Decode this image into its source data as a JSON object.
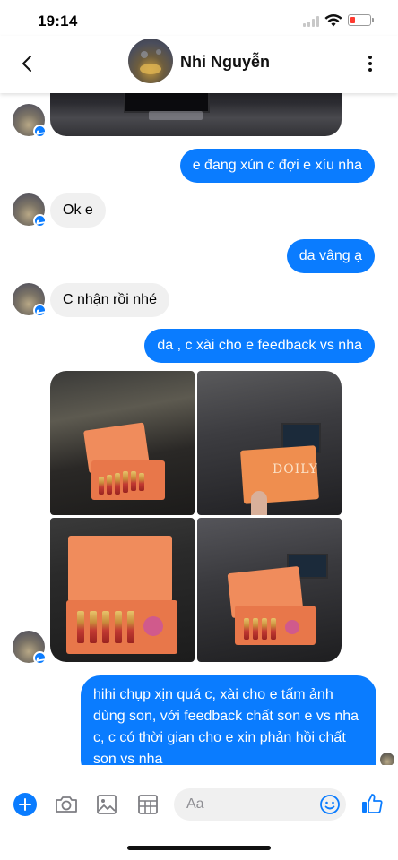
{
  "status": {
    "time": "19:14"
  },
  "contact": {
    "name": "Nhi Nguyễn"
  },
  "messages": [
    {
      "dir": "out",
      "text": "e đang xún c đợi e xíu nha"
    },
    {
      "dir": "in",
      "text": "Ok e"
    },
    {
      "dir": "out",
      "text": "da vâng ạ"
    },
    {
      "dir": "in",
      "text": "C nhận rồi nhé"
    },
    {
      "dir": "out",
      "text": "da , c xài cho e feedback vs nha"
    },
    {
      "dir": "out",
      "text": "hihi chụp xịn quá c, xài cho e tấm ảnh dùng son, với feedback chất son e vs nha c, c có thời gian cho e xin phản hồi chất son vs nha"
    }
  ],
  "photos": {
    "envelope_text": "DOILY"
  },
  "composer": {
    "placeholder": "Aa"
  },
  "colors": {
    "accent": "#0a7cff",
    "incoming_bubble": "#f0f0f0",
    "battery_low": "#ff3b30"
  },
  "icons": [
    "back-arrow-icon",
    "more-vertical-icon",
    "messenger-badge-icon",
    "plus-icon",
    "camera-icon",
    "gallery-icon",
    "gif-icon",
    "emoji-icon",
    "thumbs-up-icon",
    "wifi-icon",
    "signal-icon",
    "battery-icon"
  ]
}
